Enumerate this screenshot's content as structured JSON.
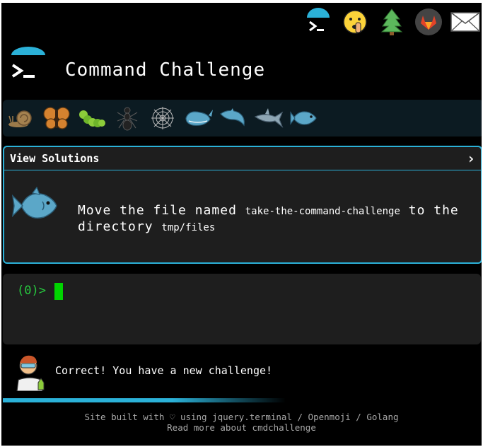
{
  "header": {
    "title": "Command Challenge"
  },
  "panel": {
    "heading": "View Solutions",
    "toggle_glyph": "›",
    "challenge_prefix": "Move the file named",
    "challenge_file": "take-the-command-challenge",
    "challenge_middle": "to the directory",
    "challenge_dir": "tmp/files"
  },
  "terminal": {
    "prompt": "(0)>"
  },
  "feedback": {
    "message": "Correct! You have a new challenge!"
  },
  "footer": {
    "line1": "Site built with ♡ using jquery.terminal / Openmoji / Golang",
    "line2": "Read more about cmdchallenge"
  },
  "top_icons": [
    "terminal-icon",
    "shushing-face-icon",
    "tree-icon",
    "gitlab-icon",
    "mail-icon"
  ],
  "levels": [
    "snail-icon",
    "butterfly-icon",
    "caterpillar-icon",
    "ant-icon",
    "spider-web-icon",
    "whale-icon",
    "dolphin-icon",
    "shark-icon",
    "fish-icon"
  ],
  "progress_percent": 60,
  "colors": {
    "accent": "#2bb1d8",
    "prompt_green": "#27c93f",
    "cursor_green": "#00d400"
  }
}
